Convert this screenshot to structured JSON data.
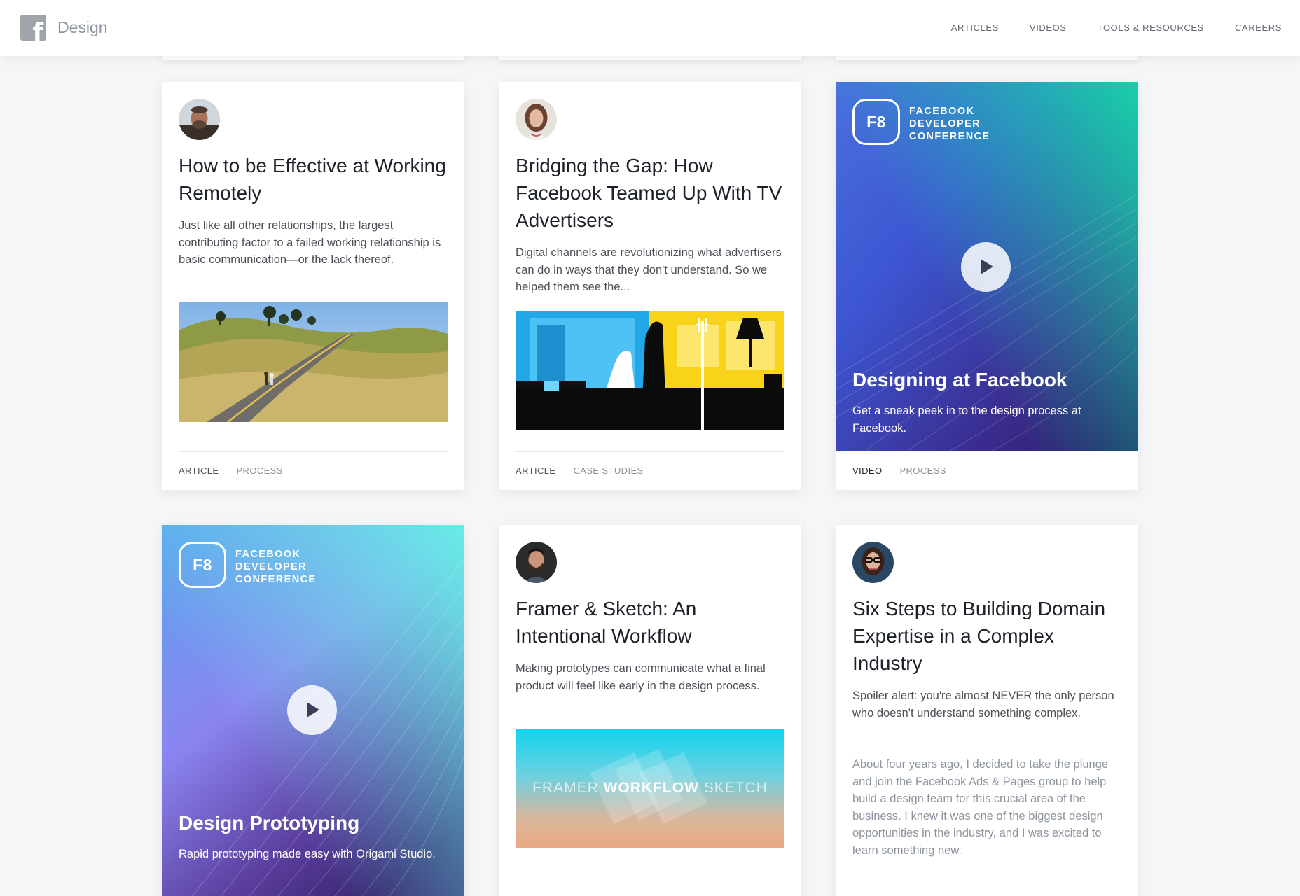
{
  "header": {
    "brand": "Design",
    "nav": [
      {
        "label": "ARTICLES"
      },
      {
        "label": "VIDEOS"
      },
      {
        "label": "TOOLS & RESOURCES"
      },
      {
        "label": "CAREERS"
      }
    ]
  },
  "cards": {
    "remote": {
      "title": "How to be Effective at Working Remotely",
      "desc": "Just like all other relationships, the largest contributing factor to a failed working relationship is basic communication—or the lack thereof.",
      "tag_primary": "ARTICLE",
      "tag_secondary": "PROCESS"
    },
    "bridging": {
      "title": "Bridging the Gap: How Facebook Teamed Up With TV Advertisers",
      "desc": "Digital channels are revolutionizing what advertisers can do in ways that they don't understand. So we helped them see the...",
      "tag_primary": "ARTICLE",
      "tag_secondary": "CASE STUDIES"
    },
    "designing": {
      "badge": "F8",
      "conf_line1": "FACEBOOK",
      "conf_line2": "DEVELOPER",
      "conf_line3": "CONFERENCE",
      "title": "Designing at Facebook",
      "desc": "Get a sneak peek in to the design process at Facebook.",
      "tag_primary": "VIDEO",
      "tag_secondary": "PROCESS"
    },
    "prototyping": {
      "badge": "F8",
      "conf_line1": "FACEBOOK",
      "conf_line2": "DEVELOPER",
      "conf_line3": "CONFERENCE",
      "title": "Design Prototyping",
      "desc": "Rapid prototyping made easy with Origami Studio."
    },
    "framer": {
      "title": "Framer & Sketch: An Intentional Workflow",
      "desc": "Making prototypes can communicate what a final product will feel like early in the design process.",
      "thumb_left": "FRAMER",
      "thumb_mid": "WORKFLOW",
      "thumb_right": "SKETCH"
    },
    "domain": {
      "title": "Six Steps to Building Domain Expertise in a Complex Industry",
      "desc": "Spoiler alert: you're almost NEVER the only person who doesn't understand something complex.",
      "body": "About four years ago, I decided to take the plunge and join the Facebook Ads & Pages group to help build a design team for this crucial area of the business. I knew it was one of the biggest design opportunities in the industry, and I was excited to learn something new."
    }
  },
  "colors": {
    "accent_text": "#1d2129",
    "muted": "#8d949e",
    "page_bg": "#f5f6f7"
  }
}
